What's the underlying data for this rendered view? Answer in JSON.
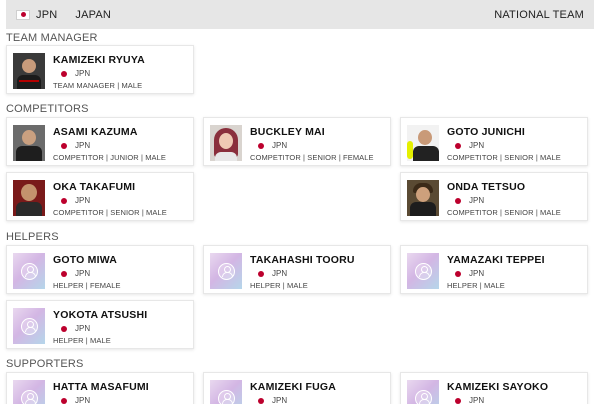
{
  "header": {
    "country_code": "JPN",
    "country_name": "JAPAN",
    "team_label": "NATIONAL TEAM",
    "flag_icon": "japan-flag-icon"
  },
  "colors": {
    "flag_red": "#bc002d",
    "topbar_bg": "#e6e6e6"
  },
  "sections": {
    "team_manager": "TEAM MANAGER",
    "competitors": "COMPETITORS",
    "helpers": "HELPERS",
    "supporters": "SUPPORTERS"
  },
  "members": {
    "m1": {
      "name": "KAMIZEKI RYUYA",
      "country": "JPN",
      "role": "TEAM MANAGER | MALE"
    },
    "c1": {
      "name": "ASAMI KAZUMA",
      "country": "JPN",
      "role": "COMPETITOR | JUNIOR | MALE"
    },
    "c2": {
      "name": "BUCKLEY MAI",
      "country": "JPN",
      "role": "COMPETITOR | SENIOR | FEMALE"
    },
    "c3": {
      "name": "GOTO JUNICHI",
      "country": "JPN",
      "role": "COMPETITOR | SENIOR | MALE"
    },
    "c4": {
      "name": "OKA TAKAFUMI",
      "country": "JPN",
      "role": "COMPETITOR | SENIOR | MALE"
    },
    "c5": {
      "name": "ONDA TETSUO",
      "country": "JPN",
      "role": "COMPETITOR | SENIOR | MALE"
    },
    "h1": {
      "name": "GOTO MIWA",
      "country": "JPN",
      "role": "HELPER | FEMALE"
    },
    "h2": {
      "name": "TAKAHASHI TOORU",
      "country": "JPN",
      "role": "HELPER | MALE"
    },
    "h3": {
      "name": "YAMAZAKI TEPPEI",
      "country": "JPN",
      "role": "HELPER | MALE"
    },
    "h4": {
      "name": "YOKOTA ATSUSHI",
      "country": "JPN",
      "role": "HELPER | MALE"
    },
    "s1": {
      "name": "HATTA MASAFUMI",
      "country": "JPN",
      "role": ""
    },
    "s2": {
      "name": "KAMIZEKI FUGA",
      "country": "JPN",
      "role": ""
    },
    "s3": {
      "name": "KAMIZEKI SAYOKO",
      "country": "JPN",
      "role": ""
    }
  }
}
